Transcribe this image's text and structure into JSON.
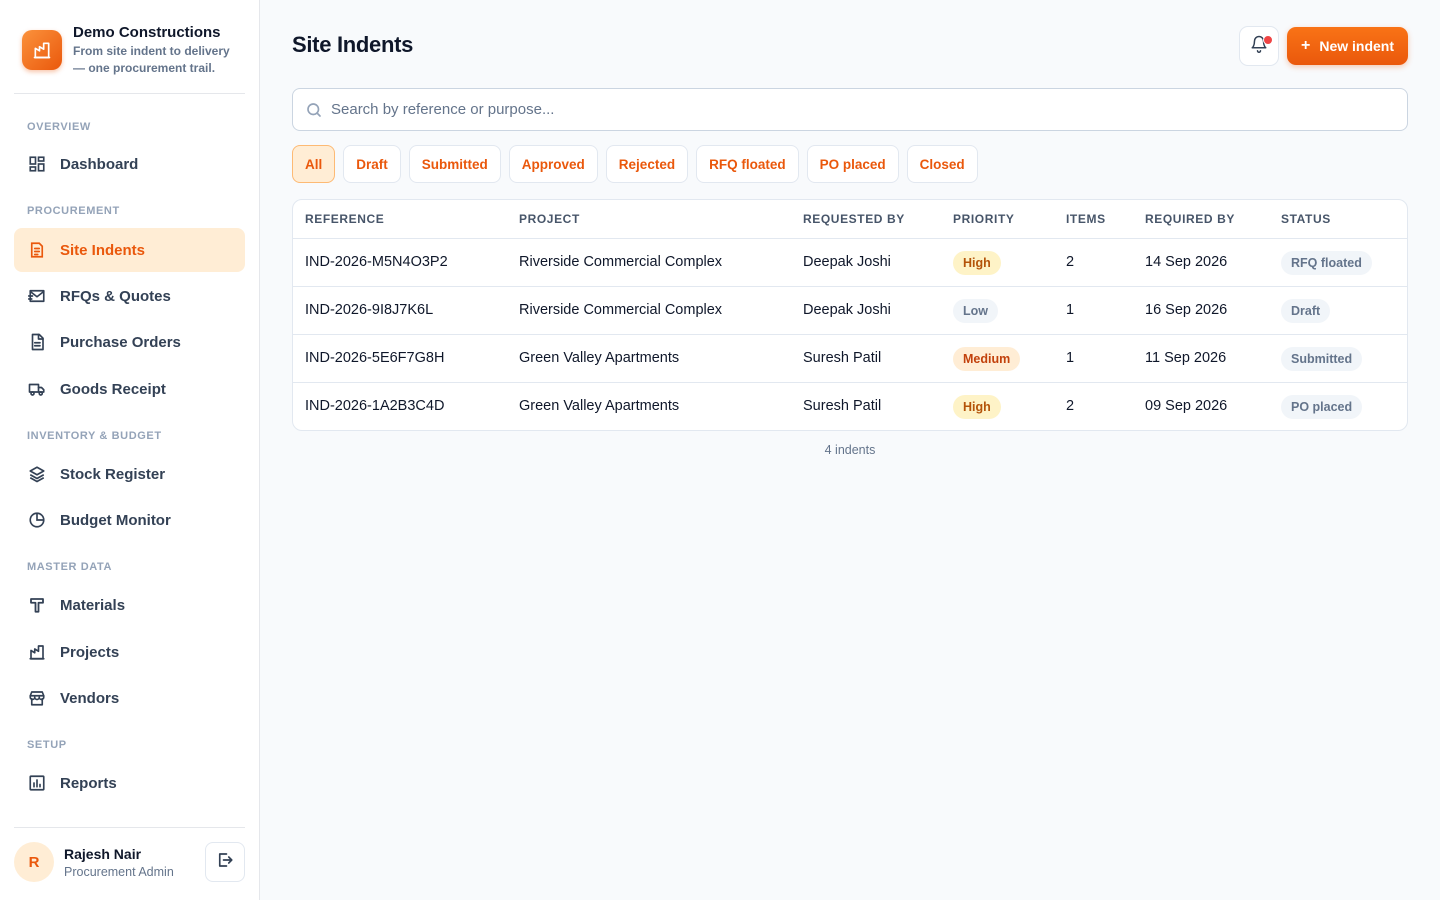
{
  "brand": {
    "name": "Demo Constructions",
    "tagline": "From site indent to delivery — one procurement trail."
  },
  "sidebar": {
    "sections": {
      "overview": "OVERVIEW",
      "procurement": "PROCUREMENT",
      "inventory": "INVENTORY & BUDGET",
      "master": "MASTER DATA",
      "setup": "SETUP"
    },
    "items": [
      {
        "label": "Dashboard",
        "icon": "grid-icon"
      },
      {
        "label": "Site Indents",
        "icon": "clipboard-list-icon",
        "active": true
      },
      {
        "label": "RFQs & Quotes",
        "icon": "mail-send-icon"
      },
      {
        "label": "Purchase Orders",
        "icon": "document-icon"
      },
      {
        "label": "Goods Receipt",
        "icon": "truck-icon"
      },
      {
        "label": "Stock Register",
        "icon": "layers-icon"
      },
      {
        "label": "Budget Monitor",
        "icon": "pie-chart-icon"
      },
      {
        "label": "Materials",
        "icon": "hammer-icon"
      },
      {
        "label": "Projects",
        "icon": "building-icon"
      },
      {
        "label": "Vendors",
        "icon": "store-icon"
      },
      {
        "label": "Reports",
        "icon": "bar-chart-icon"
      }
    ]
  },
  "user": {
    "initial": "R",
    "name": "Rajesh Nair",
    "role": "Procurement Admin"
  },
  "header": {
    "title": "Site Indents",
    "new_button": "New indent"
  },
  "search": {
    "placeholder": "Search by reference or purpose..."
  },
  "filters": [
    "All",
    "Draft",
    "Submitted",
    "Approved",
    "Rejected",
    "RFQ floated",
    "PO placed",
    "Closed"
  ],
  "active_filter": "All",
  "table": {
    "columns": [
      "REFERENCE",
      "PROJECT",
      "REQUESTED BY",
      "PRIORITY",
      "ITEMS",
      "REQUIRED BY",
      "STATUS"
    ],
    "rows": [
      {
        "reference": "IND-2026-M5N4O3P2",
        "project": "Riverside Commercial Complex",
        "requested_by": "Deepak Joshi",
        "priority": "High",
        "items": "2",
        "required_by": "14 Sep 2026",
        "status": "RFQ floated"
      },
      {
        "reference": "IND-2026-9I8J7K6L",
        "project": "Riverside Commercial Complex",
        "requested_by": "Deepak Joshi",
        "priority": "Low",
        "items": "1",
        "required_by": "16 Sep 2026",
        "status": "Draft"
      },
      {
        "reference": "IND-2026-5E6F7G8H",
        "project": "Green Valley Apartments",
        "requested_by": "Suresh Patil",
        "priority": "Medium",
        "items": "1",
        "required_by": "11 Sep 2026",
        "status": "Submitted"
      },
      {
        "reference": "IND-2026-1A2B3C4D",
        "project": "Green Valley Apartments",
        "requested_by": "Suresh Patil",
        "priority": "High",
        "items": "2",
        "required_by": "09 Sep 2026",
        "status": "PO placed"
      }
    ],
    "footer": "4 indents"
  },
  "colors": {
    "accent": "#ea580c",
    "accent_light": "#ffedd5",
    "priority_high_bg": "#fef3c7",
    "notification_dot": "#ef4444"
  }
}
